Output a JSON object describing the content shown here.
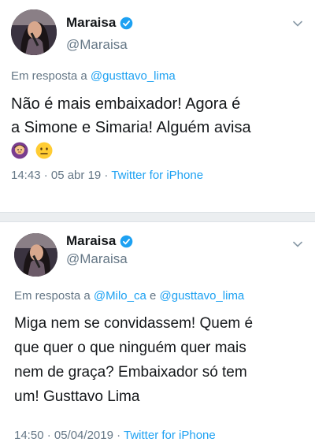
{
  "tweets": [
    {
      "display_name": "Maraisa",
      "handle": "@Maraisa",
      "reply_prefix": "Em resposta a",
      "mention1": "@gusttavo_lima",
      "text_lines": [
        "Não é mais embaixador! Agora é",
        "a Simone e Simaria! Alguém avisa"
      ],
      "emojis": [
        "woman-gesturing-no-emoji",
        "neutral-face-emoji"
      ],
      "date": "14:43 · 05 abr 19 ·",
      "source": "Twitter for iPhone"
    },
    {
      "display_name": "Maraisa",
      "handle": "@Maraisa",
      "reply_prefix": "Em resposta a",
      "mention1": "@Milo_ca",
      "connector": "e",
      "mention2": "@gusttavo_lima",
      "text_lines": [
        "Miga nem se convidassem! Quem é",
        "que quer o que ninguém quer mais",
        "nem de graça? Embaixador só tem",
        "um! Gusttavo Lima"
      ],
      "date": "14:50 · 05/04/2019 ·",
      "source": "Twitter for iPhone"
    }
  ],
  "colors": {
    "link": "#1da1f2",
    "secondary_text": "#657786",
    "primary_text": "#14171a",
    "verified": "#1da1f2",
    "divider": "#ebeef0"
  }
}
